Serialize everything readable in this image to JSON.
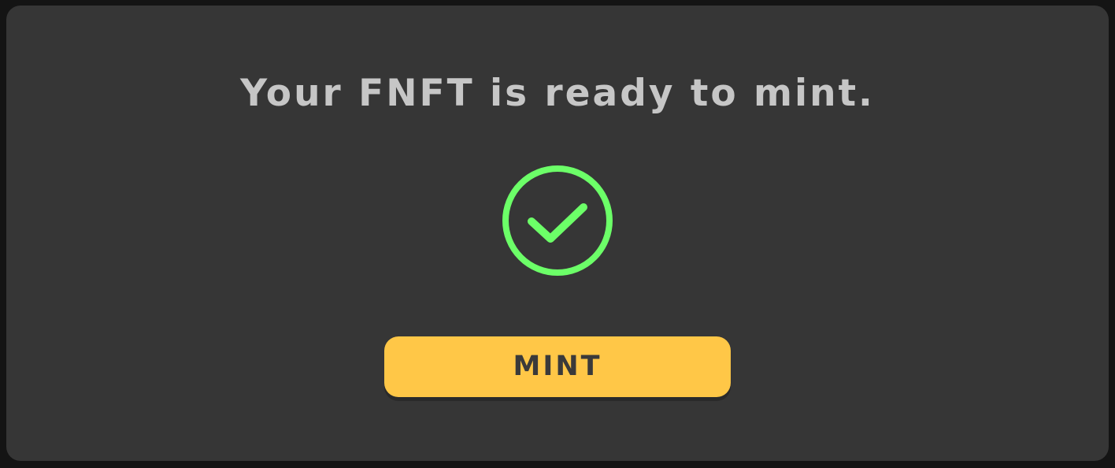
{
  "dialog": {
    "message": "Your FNFT is ready to mint.",
    "status_icon": "check-circle-icon",
    "mint_label": "MINT"
  },
  "colors": {
    "card_background": "#363636",
    "text": "#c6c6c6",
    "success_green": "#6cff68",
    "button_yellow": "#ffc747",
    "button_text": "#3a3a3a"
  }
}
